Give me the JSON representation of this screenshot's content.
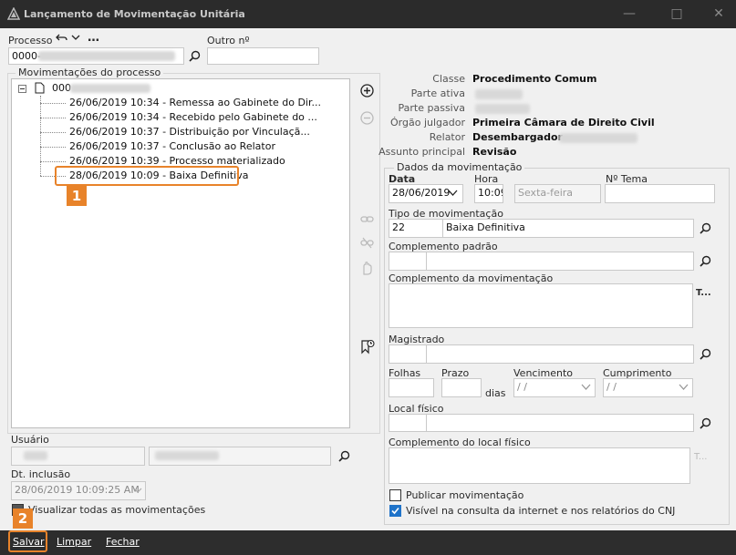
{
  "window": {
    "title": "Lançamento de Movimentação Unitária"
  },
  "header": {
    "processo_label": "Processo",
    "processo_value": "0000-",
    "outro_label": "Outro nº",
    "outro_value": ""
  },
  "tree": {
    "group_label": "Movimentações do processo",
    "root_label": "000",
    "items": [
      "26/06/2019 10:34 - Remessa ao Gabinete do Dir...",
      "26/06/2019 10:34 - Recebido pelo Gabinete do ...",
      "26/06/2019 10:37 - Distribuição por Vinculaçã...",
      "26/06/2019 10:37 - Conclusão ao Relator",
      "26/06/2019 10:39 - Processo materializado",
      "28/06/2019 10:09 - Baixa Definitiva"
    ]
  },
  "info": {
    "classe_k": "Classe",
    "classe_v": "Procedimento Comum",
    "ativa_k": "Parte ativa",
    "passiva_k": "Parte passiva",
    "orgao_k": "Órgão julgador",
    "orgao_v": "Primeira Câmara de Direito Civil",
    "relator_k": "Relator",
    "relator_v": "Desembargador",
    "assunto_k": "Assunto principal",
    "assunto_v": "Revisão"
  },
  "dados": {
    "group_label": "Dados da movimentação",
    "data_label": "Data",
    "data_value": "28/06/2019",
    "hora_label": "Hora",
    "hora_value": "10:09",
    "dia_value": "Sexta-feira",
    "tema_label": "Nº Tema",
    "tipo_label": "Tipo de movimentação",
    "tipo_code": "22",
    "tipo_desc": "Baixa Definitiva",
    "comp_padrao_label": "Complemento padrão",
    "comp_mov_label": "Complemento da movimentação",
    "t_glyph": "T...",
    "magistrado_label": "Magistrado",
    "folhas_label": "Folhas",
    "prazo_label": "Prazo",
    "dias_label": "dias",
    "vencimento_label": "Vencimento",
    "vencimento_value": "/ /",
    "cumprimento_label": "Cumprimento",
    "cumprimento_value": "/ /",
    "local_label": "Local físico",
    "comp_local_label": "Complemento do local físico",
    "publicar_label": "Publicar movimentação",
    "visivel_label": "Visível na consulta da internet e nos relatórios do CNJ"
  },
  "left_bottom": {
    "usuario_label": "Usuário",
    "dt_label": "Dt. inclusão",
    "dt_value": "28/06/2019 10:09:25 AM",
    "visualizar_label": "Visualizar todas as movimentações"
  },
  "footer": {
    "salvar": "Salvar",
    "limpar": "Limpar",
    "fechar": "Fechar"
  },
  "annotations": {
    "badge1": "1",
    "badge2": "2"
  },
  "colors": {
    "accent": "#e8832a",
    "titlebar": "#2b2b2b",
    "checkbox": "#1f73c9"
  }
}
